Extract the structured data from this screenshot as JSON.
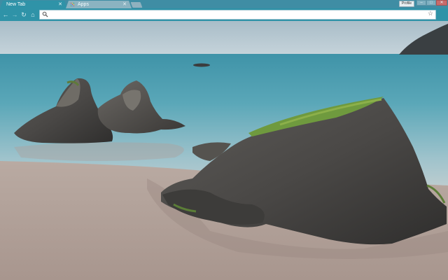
{
  "browser": {
    "tabs": [
      {
        "title": "New Tab",
        "active": true
      },
      {
        "title": "Apps",
        "active": false
      }
    ],
    "profile_label": "Profile",
    "window_controls": [
      "minimize-icon",
      "maximize-icon",
      "close-icon"
    ],
    "omnibox": {
      "value": "",
      "placeholder": ""
    },
    "toolbar_icons": [
      "back-arrow-icon",
      "forward-arrow-icon",
      "reload-icon",
      "home-icon",
      "search-icon",
      "bookmark-star-icon"
    ]
  },
  "theme": {
    "accent": "#2f93a8",
    "tab_inactive": "#8bb3c1",
    "sky": "#b8c9d2",
    "sea": "#4f9db0",
    "sand": "#b3a49c"
  },
  "apps_favicon_colors": [
    "#e94235",
    "#fbbc04",
    "#34a853",
    "#4285f4",
    "#e94235",
    "#fbbc04",
    "#34a853",
    "#4285f4",
    "#e94235"
  ]
}
